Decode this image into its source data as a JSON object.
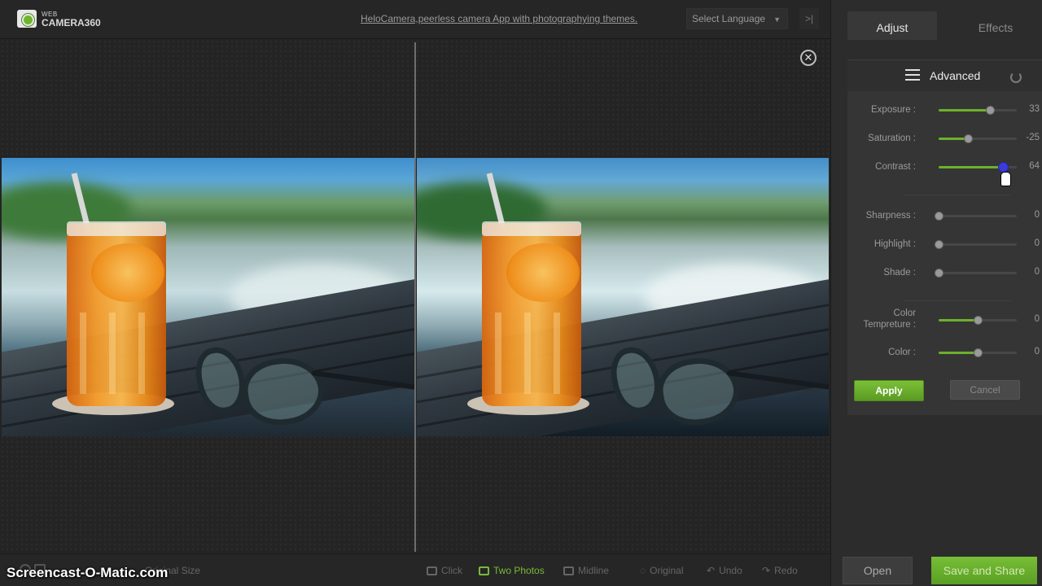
{
  "app": {
    "logo_line1": "WEB",
    "logo_line2": "CAMERA360"
  },
  "header": {
    "tagline": "HeloCamera,peerless camera App with photographying themes.",
    "language_select": "Select Language",
    "collapse_label": ">|"
  },
  "canvas": {
    "close_label": "✕"
  },
  "bottom": {
    "original_size": "Original Size",
    "click": "Click",
    "two_photos": "Two Photos",
    "midline": "Midline",
    "original": "Original",
    "undo": "Undo",
    "redo": "Redo"
  },
  "watermark": "Screencast-O-Matic.com",
  "panel": {
    "tabs": [
      "Adjust",
      "Effects"
    ],
    "active_tab": "Adjust",
    "section_title": "Advanced",
    "sliders": [
      {
        "label": "Exposure :",
        "value": "33",
        "level": 0.66
      },
      {
        "label": "Saturation :",
        "value": "-25",
        "level": 0.375
      },
      {
        "label": "Contrast :",
        "value": "64",
        "level": 0.82
      },
      {
        "label": "Sharpness :",
        "value": "0",
        "level": 0.0
      },
      {
        "label": "Highlight :",
        "value": "0",
        "level": 0.0
      },
      {
        "label": "Shade :",
        "value": "0",
        "level": 0.0
      },
      {
        "label": "Color Tempreture :",
        "value": "0",
        "level": 0.5
      },
      {
        "label": "Color :",
        "value": "0",
        "level": 0.5
      }
    ],
    "apply_label": "Apply",
    "cancel_label": "Cancel",
    "open_label": "Open",
    "save_label": "Save and Share"
  },
  "colors": {
    "accent": "#6db02c",
    "active_knob": "#3b3bd8"
  }
}
